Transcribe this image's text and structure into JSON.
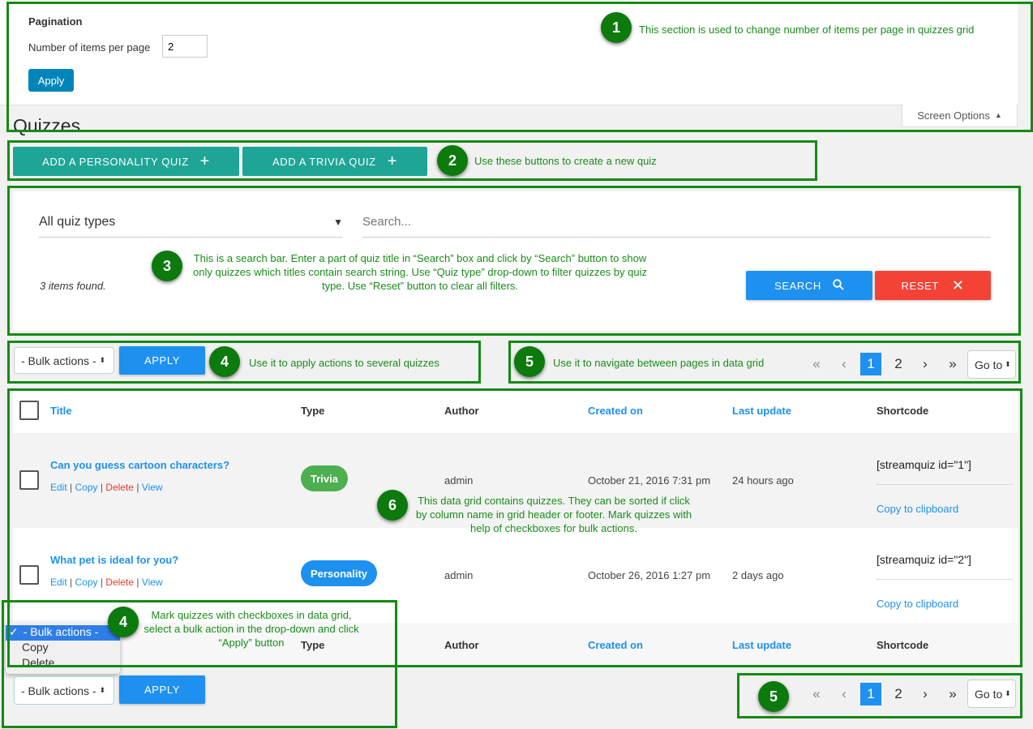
{
  "screen_options": {
    "section_title": "Pagination",
    "items_label": "Number of items per page",
    "items_value": "2",
    "apply": "Apply",
    "tab_label": "Screen Options"
  },
  "page_title": "Quizzes",
  "add_buttons": {
    "personality": "ADD A PERSONALITY QUIZ",
    "trivia": "ADD A TRIVIA QUIZ"
  },
  "search": {
    "quiz_type": "All quiz types",
    "placeholder": "Search...",
    "found": "3 items found.",
    "search_btn": "SEARCH",
    "reset_btn": "RESET"
  },
  "bulk": {
    "select": "- Bulk actions -",
    "apply": "APPLY",
    "dropdown_options": [
      "- Bulk actions -",
      "Copy",
      "Delete"
    ]
  },
  "pagination": {
    "first": "«",
    "prev": "‹",
    "pages": [
      "1",
      "2"
    ],
    "current": "1",
    "next": "›",
    "last": "»",
    "goto": "Go to"
  },
  "table": {
    "headers": {
      "title": "Title",
      "type": "Type",
      "author": "Author",
      "created": "Created on",
      "updated": "Last update",
      "shortcode": "Shortcode"
    },
    "row_actions": {
      "edit": "Edit",
      "copy": "Copy",
      "delete": "Delete",
      "view": "View"
    },
    "rows": [
      {
        "title": "Can you guess cartoon characters?",
        "type": "Trivia",
        "author": "admin",
        "created": "October 21, 2016 7:31 pm",
        "updated": "24 hours ago",
        "shortcode": "[streamquiz id=\"1\"]",
        "copy": "Copy to clipboard"
      },
      {
        "title": "What pet is ideal for you?",
        "type": "Personality",
        "author": "admin",
        "created": "October 26, 2016 1:27 pm",
        "updated": "2 days ago",
        "shortcode": "[streamquiz id=\"2\"]",
        "copy": "Copy to clipboard"
      }
    ]
  },
  "colors": {
    "trivia": "#4caf50",
    "personality": "#1e90f0",
    "accent": "#1e90f0",
    "teal": "#1fa596",
    "reset": "#f44336",
    "annotation": "#148a14"
  },
  "annotations": [
    {
      "n": "1",
      "text": "This section is used to change number of items per page in quizzes grid"
    },
    {
      "n": "2",
      "text": "Use these buttons to create a new quiz"
    },
    {
      "n": "3",
      "text": "This is a search bar. Enter a part of quiz title in “Search” box and click by “Search” button to show only quizzes which titles contain search string. Use “Quiz type” drop-down to filter quizzes by quiz type. Use “Reset” button to clear all filters."
    },
    {
      "n": "4",
      "text": "Use it to apply actions to several quizzes"
    },
    {
      "n": "5",
      "text": "Use it to navigate between pages in data grid"
    },
    {
      "n": "6",
      "text": "This data grid contains quizzes. They can be sorted if click by column name in grid header or footer. Mark quizzes with help of checkboxes for bulk actions."
    },
    {
      "n": "4",
      "text": "Mark quizzes with checkboxes in data grid, select a bulk action in the drop-down and click “Apply” button"
    },
    {
      "n": "5",
      "text": ""
    }
  ]
}
